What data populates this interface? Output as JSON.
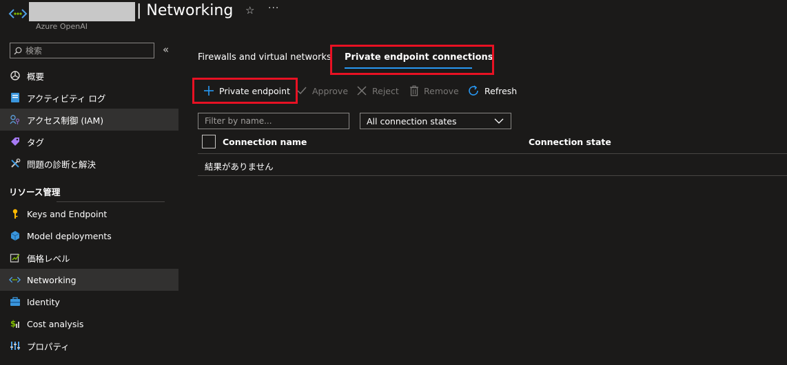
{
  "header": {
    "title": "| Networking",
    "subtitle": "Azure OpenAI",
    "star_icon": "☆",
    "more_icon": "···"
  },
  "sidebar": {
    "search_placeholder": "検索",
    "collapse_icon": "«",
    "items": [
      {
        "label": "概要",
        "icon": "openai-icon"
      },
      {
        "label": "アクティビティ ログ",
        "icon": "activity-log-icon"
      },
      {
        "label": "アクセス制御 (IAM)",
        "icon": "iam-icon"
      },
      {
        "label": "タグ",
        "icon": "tag-icon"
      },
      {
        "label": "問題の診断と解決",
        "icon": "wrench-icon"
      }
    ],
    "section_title": "リソース管理",
    "section_items": [
      {
        "label": "Keys and Endpoint",
        "icon": "key-icon"
      },
      {
        "label": "Model deployments",
        "icon": "cube-icon"
      },
      {
        "label": "価格レベル",
        "icon": "pricing-icon"
      },
      {
        "label": "Networking",
        "icon": "networking-icon"
      },
      {
        "label": "Identity",
        "icon": "identity-icon"
      },
      {
        "label": "Cost analysis",
        "icon": "cost-icon"
      },
      {
        "label": "プロパティ",
        "icon": "properties-icon"
      }
    ]
  },
  "tabs": [
    {
      "label": "Firewalls and virtual networks"
    },
    {
      "label": "Private endpoint connections"
    }
  ],
  "toolbar": {
    "private_endpoint": "Private endpoint",
    "approve": "Approve",
    "reject": "Reject",
    "remove": "Remove",
    "refresh": "Refresh"
  },
  "filters": {
    "name_placeholder": "Filter by name...",
    "state_selected": "All connection states"
  },
  "table": {
    "columns": [
      "Connection name",
      "Connection state"
    ],
    "empty_message": "結果がありません"
  },
  "colors": {
    "accent": "#2899f5",
    "highlight": "#e81123",
    "background": "#1b1a19",
    "active_item": "#323130"
  }
}
